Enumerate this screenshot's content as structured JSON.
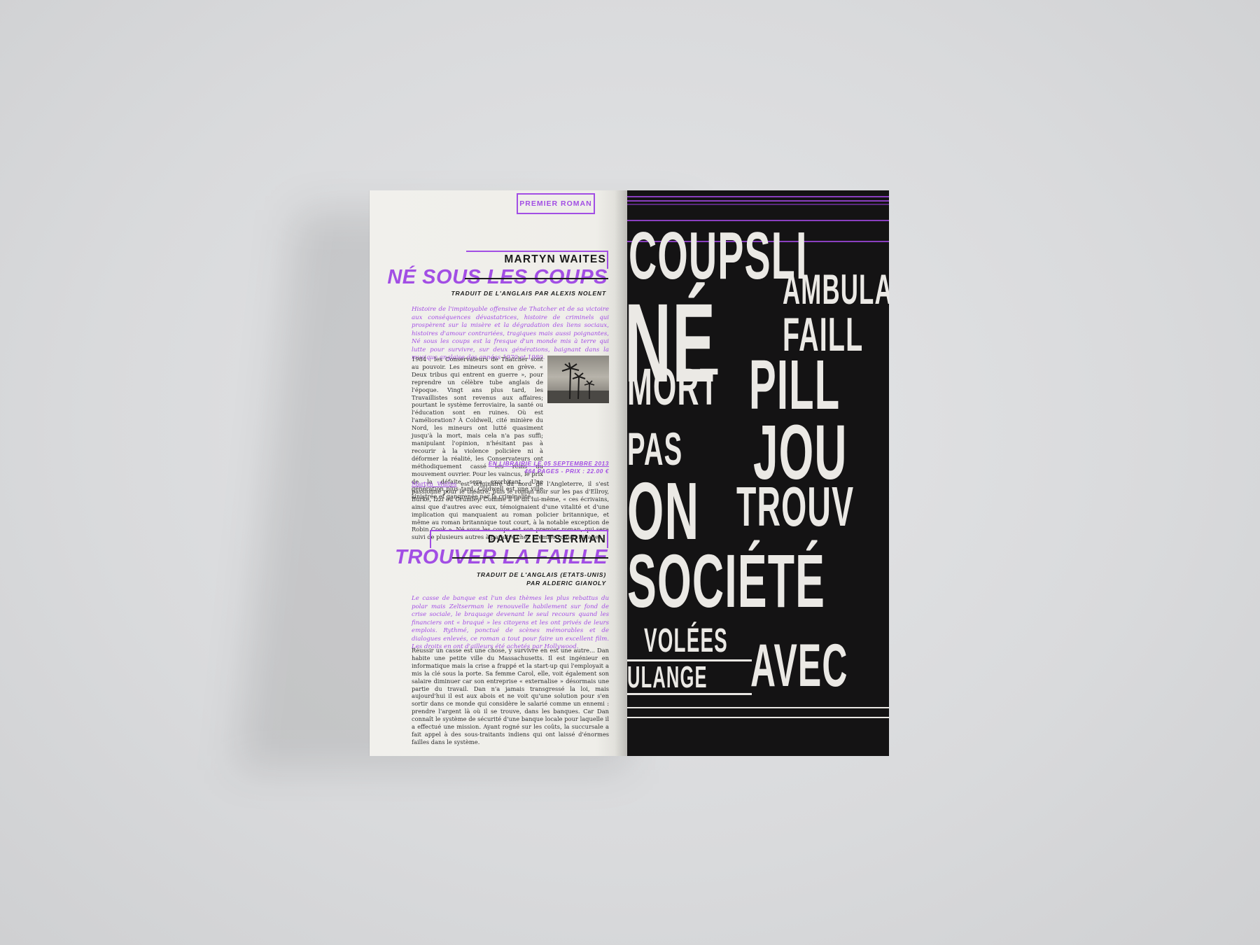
{
  "left_page": {
    "stamp": "PREMIER ROMAN",
    "book1": {
      "author": "MARTYN WAITES",
      "title": "NÉ SOUS LES COUPS",
      "translator": "TRADUIT DE L'ANGLAIS PAR ALEXIS NOLENT",
      "lede": "Histoire de l'impitoyable offensive de Thatcher et de sa victoire aux conséquences dévastatrices, histoire de criminels qui prospèrent sur la misère et la dégradation des liens sociaux, histoires d'amour contrariées, tragiques mais aussi poignantes, Né sous les coups est la fresque d'un monde mis à terre qui lutte pour survivre, sur deux générations, baignant dans la musique anglaise des années 1970 et 1980.",
      "body": "1984 : les Conservateurs de Thatcher sont au pouvoir. Les mineurs sont en grève. « Deux tribus qui entrent en guerre », pour reprendre un célèbre tube anglais de l'époque. Vingt ans plus tard, les Travaillistes sont revenus aux affaires; pourtant le système ferroviaire, la santé ou l'éducation sont en ruines. Où est l'amélioration? À Coldwell, cité minière du Nord, les mineurs ont lutté quasiment jusqu'à la mort, mais cela n'a pas suffi; manipulant l'opinion, n'hésitant pas à recourir à la violence policière ni à déformer la réalité, les Conservateurs ont méthodiquement cassé les reins du mouvement ouvrier. Pour les vaincus, le prix de la défaite sera exorbitant. Une génération plus tard, Coldwell est une ville sinistrée et gangrenée par la criminalité.",
      "release": "EN LIBRAIRIE LE 05 SEPTEMBRE 2013",
      "pages_price": "464 PAGES - PRIX : 22.00 €",
      "bio_name": "Martyn Waites",
      "bio": " est originaire du nord de l'Angleterre, il s'est passionné pour le théâtre, puis le roman noir sur les pas d'Ellroy, Burke, Izzi ou Crumley. Comme il le dit lui-même, « ces écrivains, ainsi que d'autres avec eux, témoignaient d'une vitalité et d'une implication qui manquaient au roman policier britannique, et même au roman britannique tout court, à la notable exception de Robin Cook ». Né sous les coups est son premier roman, qui sera suivi de plusieurs autres à paraître chez Premier roman Rivages."
    },
    "book2": {
      "author": "DAVE ZELTSERMAN",
      "title": "TROUVER LA FAILLE",
      "translator_line1": "TRADUIT DE L'ANGLAIS (ETATS-UNIS)",
      "translator_line2": "PAR ALDERIC GIANOLY",
      "lede": "Le casse de banque est l'un des thèmes les plus rebattus du polar mais Zeltserman le renouvelle habilement sur fond de crise sociale, le braquage devenant le seul recours quand les financiers ont « braqué » les citoyens et les ont privés de leurs emplois. Rythmé, ponctué de scènes mémorables et de dialogues enlevés, ce roman a tout pour faire un excellent film. Les droits en ont d'ailleurs été achetés par Hollywood.",
      "body": "Réussir un casse est une chose, y survivre en est une autre... Dan habite une petite ville du Massachusetts. Il est ingénieur en informatique mais la crise a frappé et la start-up qui l'employait a mis la clé sous la porte. Sa femme Carol, elle, voit également son salaire diminuer car son entreprise « externalise » désormais une partie du travail. Dan n'a jamais transgressé la loi, mais aujourd'hui il est aux abois et ne voit qu'une solution pour s'en sortir dans ce monde qui considère le salarié comme un ennemi : prendre l'argent là où il se trouve, dans les banques. Car Dan connaît le système de sécurité d'une banque locale pour laquelle il a effectué une mission. Ayant rogné sur les coûts, la succursale a fait appel à des sous-traitants indiens qui ont laissé d'énormes failles dans le système."
    }
  },
  "right_page": {
    "words": [
      "COUPSLI",
      "NÉ",
      "AMBULA",
      "FAILL",
      "MORT",
      "PILL",
      "PAS",
      "JOU",
      "ON",
      "TROUV",
      "SOCIÉTÉ",
      "VOLÉES",
      "ULANGE",
      "AVEC"
    ]
  },
  "colors": {
    "accent": "#a24ee4",
    "dark": "#141314",
    "paper": "#efeee9"
  }
}
